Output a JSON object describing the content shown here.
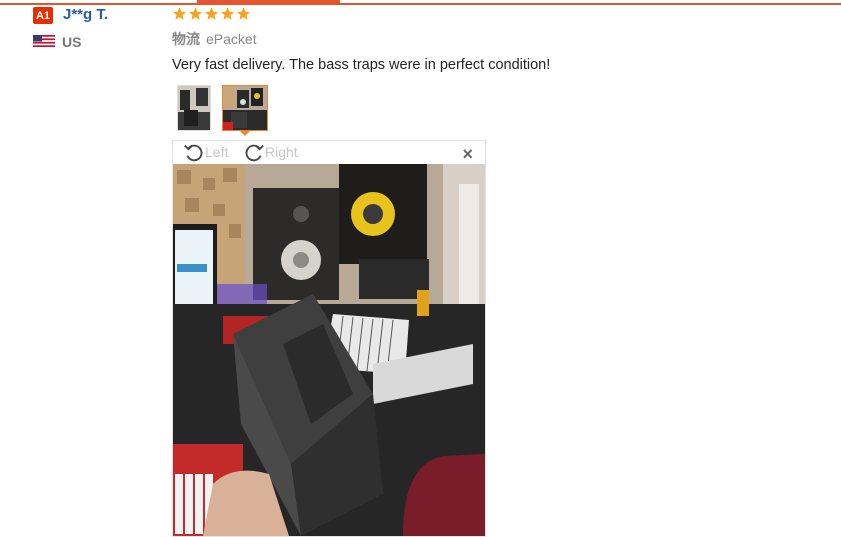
{
  "reviewer": {
    "badge": "A1",
    "name": "J**g T.",
    "country": "US"
  },
  "rating": {
    "stars": 5,
    "max": 5
  },
  "shipping": {
    "label": "物流",
    "method": "ePacket"
  },
  "review_text": "Very fast delivery. The bass traps were in perfect condition!",
  "thumbnails": {
    "count": 2,
    "selected": 2
  },
  "viewer": {
    "rotate_left": "Left",
    "rotate_right": "Right",
    "close": "×"
  },
  "colors": {
    "accent": "#e4572e",
    "star": "#f5a623",
    "name": "#2b5aa6"
  }
}
